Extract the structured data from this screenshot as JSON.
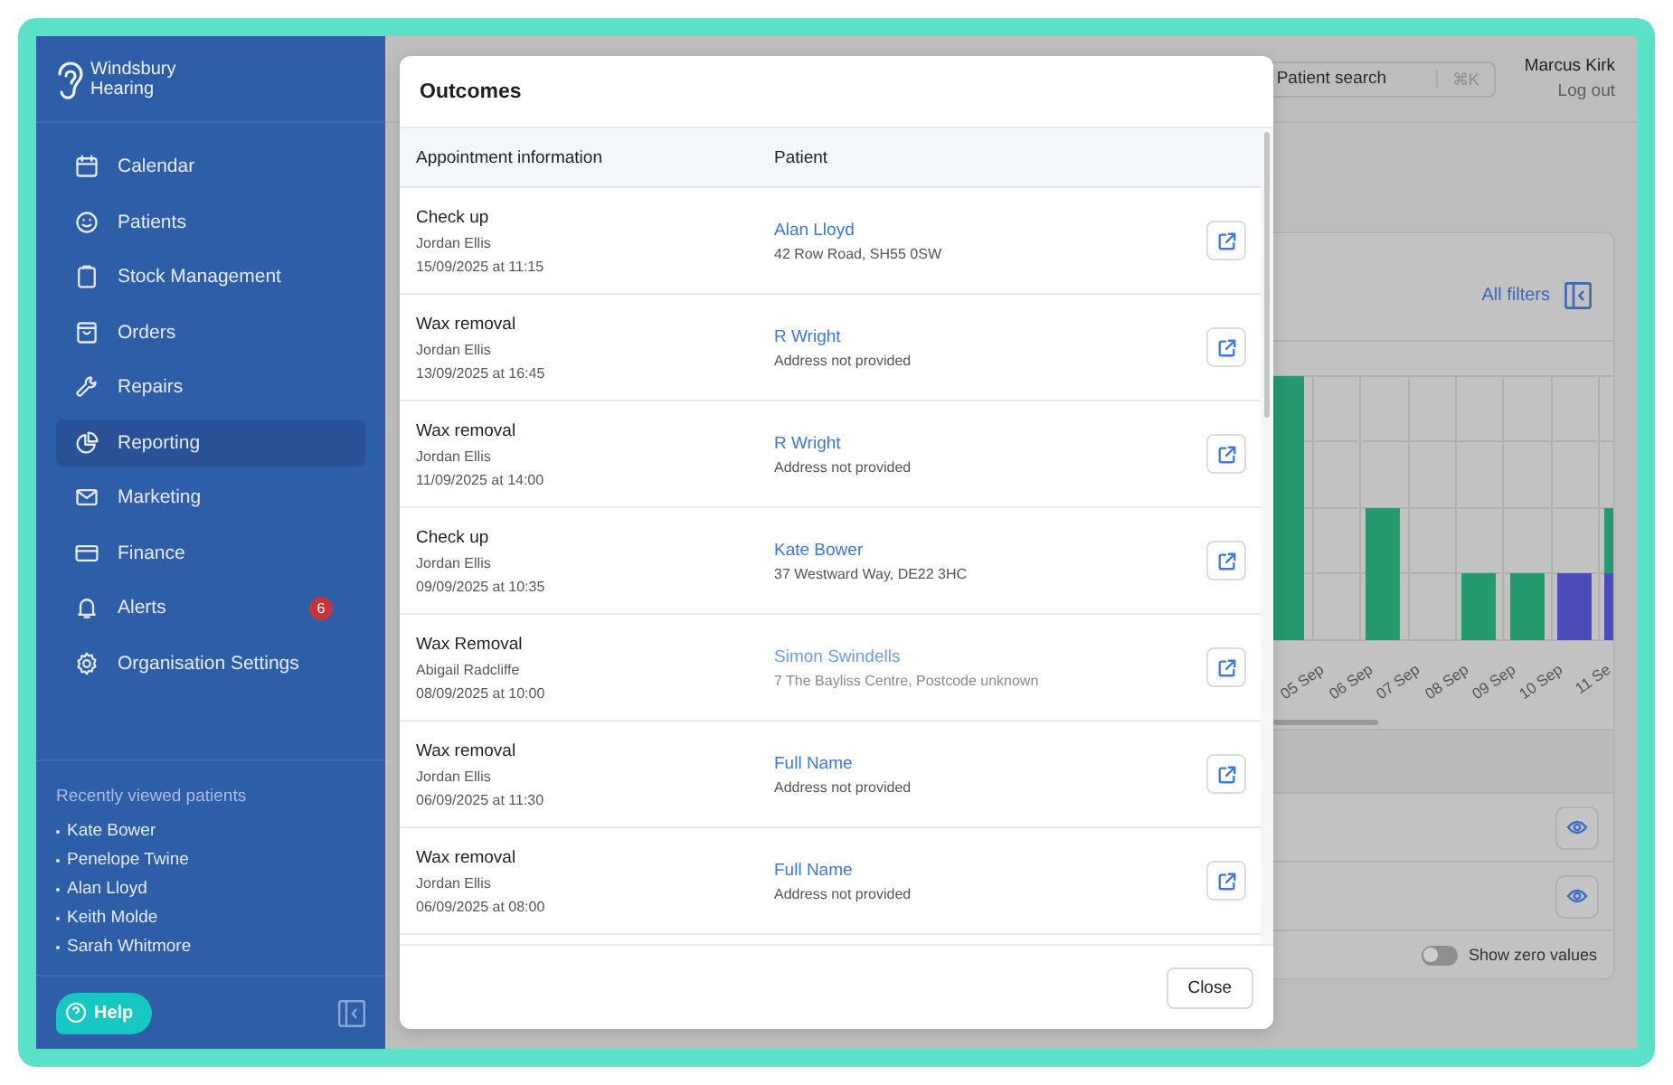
{
  "sidebar": {
    "brand": "Windsbury Hearing",
    "nav": [
      {
        "label": "Calendar",
        "kind": "calendar",
        "selected": false
      },
      {
        "label": "Patients",
        "kind": "smile",
        "selected": false
      },
      {
        "label": "Stock Management",
        "kind": "clipboard",
        "selected": false
      },
      {
        "label": "Orders",
        "kind": "bag",
        "selected": false
      },
      {
        "label": "Repairs",
        "kind": "wrench",
        "selected": false
      },
      {
        "label": "Reporting",
        "kind": "pie",
        "selected": true
      },
      {
        "label": "Marketing",
        "kind": "mail",
        "selected": false
      },
      {
        "label": "Finance",
        "kind": "card",
        "selected": false
      },
      {
        "label": "Alerts",
        "kind": "bell",
        "selected": false,
        "badge": "6"
      },
      {
        "label": "Organisation Settings",
        "kind": "gear",
        "selected": false
      }
    ],
    "recent": {
      "title": "Recently viewed patients",
      "patients": [
        "Kate Bower",
        "Penelope Twine",
        "Alan Lloyd",
        "Keith Molde",
        "Sarah Whitmore"
      ]
    },
    "help": "Help"
  },
  "topbar": {
    "search": {
      "placeholder": "Patient search",
      "shortcut": "⌘K"
    },
    "user": "Marcus Kirk",
    "logout": "Log out"
  },
  "report_card": {
    "filters_link": "All filters",
    "x_labels": [
      "05 Sep",
      "06 Sep",
      "07 Sep",
      "08 Sep",
      "09 Sep",
      "10 Sep",
      "11 Se"
    ],
    "toggle": {
      "label": "Show zero values",
      "on": false
    }
  },
  "modal": {
    "title": "Outcomes",
    "columns": [
      "Appointment information",
      "Patient"
    ],
    "rows": [
      {
        "type": "Check up",
        "clinician": "Jordan Ellis",
        "datetime": "15/09/2025 at 11:15",
        "patient": "Alan Lloyd",
        "address": "42 Row Road, SH55 0SW",
        "blurred": false
      },
      {
        "type": "Wax removal",
        "clinician": "Jordan Ellis",
        "datetime": "13/09/2025 at 16:45",
        "patient": "R Wright",
        "address": "Address not provided",
        "blurred": false
      },
      {
        "type": "Wax removal",
        "clinician": "Jordan Ellis",
        "datetime": "11/09/2025 at 14:00",
        "patient": "R Wright",
        "address": "Address not provided",
        "blurred": false
      },
      {
        "type": "Check up",
        "clinician": "Jordan Ellis",
        "datetime": "09/09/2025 at 10:35",
        "patient": "Kate Bower",
        "address": "37 Westward Way, DE22 3HC",
        "blurred": false
      },
      {
        "type": "Wax Removal",
        "clinician": "Abigail Radcliffe",
        "datetime": "08/09/2025 at 10:00",
        "patient": "Simon Swindells",
        "address": "7 The Bayliss Centre, Postcode unknown",
        "blurred": true
      },
      {
        "type": "Wax removal",
        "clinician": "Jordan Ellis",
        "datetime": "06/09/2025 at 11:30",
        "patient": "Full Name",
        "address": "Address not provided",
        "blurred": false
      },
      {
        "type": "Wax removal",
        "clinician": "Jordan Ellis",
        "datetime": "06/09/2025 at 08:00",
        "patient": "Full Name",
        "address": "Address not provided",
        "blurred": false
      }
    ],
    "close": "Close"
  }
}
